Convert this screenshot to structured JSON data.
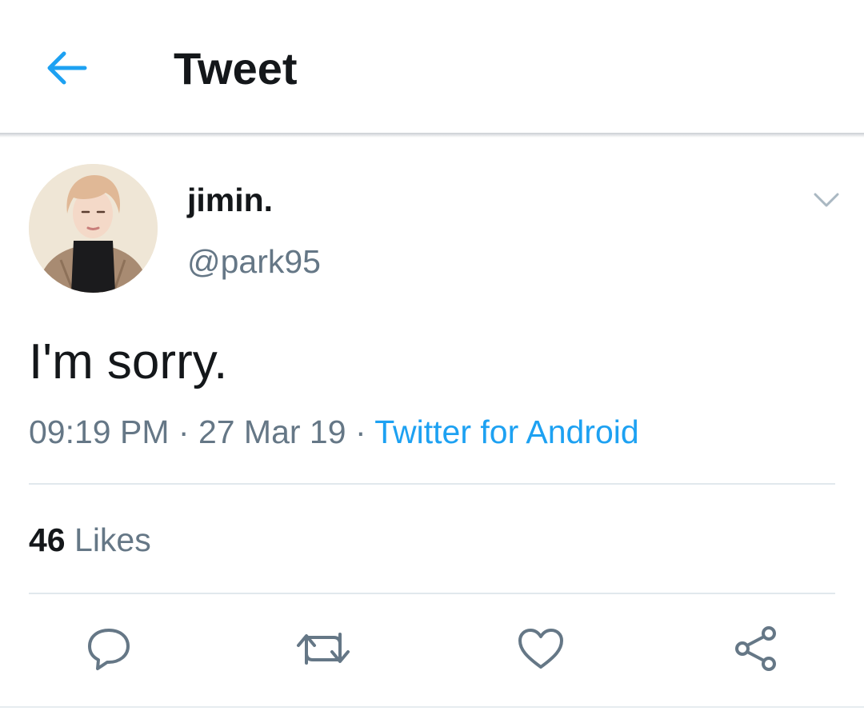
{
  "header": {
    "title": "Tweet",
    "back_icon": "arrow-left-icon"
  },
  "tweet": {
    "author": {
      "display_name": "jimin.",
      "handle": "@park95"
    },
    "text": "I'm sorry.",
    "time": "09:19 PM",
    "separator": " · ",
    "date": "27 Mar 19",
    "source": "Twitter for Android",
    "likes_count": "46",
    "likes_label": "Likes"
  },
  "actions": [
    {
      "name": "reply",
      "icon": "speech-bubble-icon"
    },
    {
      "name": "retweet",
      "icon": "retweet-arrows-icon"
    },
    {
      "name": "like",
      "icon": "heart-icon"
    },
    {
      "name": "share",
      "icon": "share-nodes-icon"
    }
  ],
  "colors": {
    "accent": "#1da1f2",
    "text_primary": "#14171a",
    "text_secondary": "#657786",
    "divider": "#e1e8ed"
  }
}
